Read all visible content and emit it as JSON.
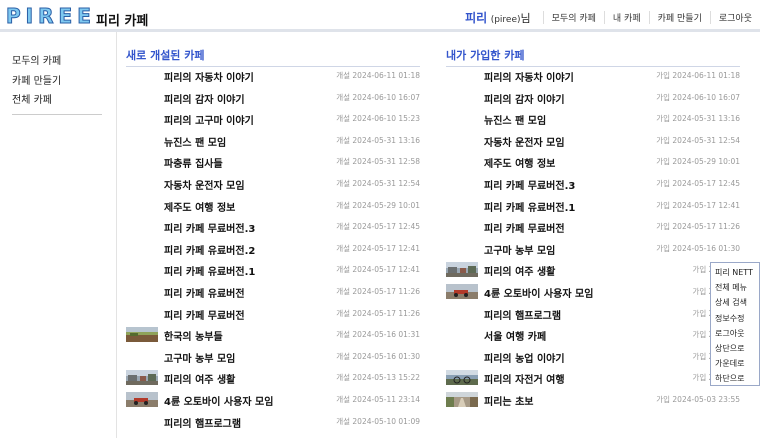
{
  "header": {
    "logo": [
      "P",
      "I",
      "R",
      "E",
      "E"
    ],
    "site_title": "피리 카페",
    "user_name": "피리",
    "user_id": "(piree)",
    "user_suffix": "님",
    "nav": [
      "모두의 카페",
      "내 카페",
      "카페 만들기",
      "로그아웃"
    ]
  },
  "sidebar": {
    "items": [
      "모두의 카페",
      "카페 만들기",
      "전체 카페"
    ],
    "active_index": 0
  },
  "new_cafes": {
    "title": "새로 개설된 카페",
    "items": [
      {
        "name": "피리의 자동차 이야기",
        "date": "개설 2024-06-11 01:18",
        "thumb": false
      },
      {
        "name": "피리의 감자 이야기",
        "date": "개설 2024-06-10 16:07",
        "thumb": false
      },
      {
        "name": "피리의 고구마 이야기",
        "date": "개설 2024-06-10 15:23",
        "thumb": false
      },
      {
        "name": "뉴진스 팬 모임",
        "date": "개설 2024-05-31 13:16",
        "thumb": false
      },
      {
        "name": "파충류 집사들",
        "date": "개설 2024-05-31 12:58",
        "thumb": false
      },
      {
        "name": "자동차 운전자 모임",
        "date": "개설 2024-05-31 12:54",
        "thumb": false
      },
      {
        "name": "제주도 여행 정보",
        "date": "개설 2024-05-29 10:01",
        "thumb": false
      },
      {
        "name": "피리 카페 무료버전.3",
        "date": "개설 2024-05-17 12:45",
        "thumb": false
      },
      {
        "name": "피리 카페 유료버전.2",
        "date": "개설 2024-05-17 12:41",
        "thumb": false
      },
      {
        "name": "피리 카페 유료버전.1",
        "date": "개설 2024-05-17 12:41",
        "thumb": false
      },
      {
        "name": "피리 카페 유료버전",
        "date": "개설 2024-05-17 11:26",
        "thumb": false
      },
      {
        "name": "피리 카페 무료버전",
        "date": "개설 2024-05-17 11:26",
        "thumb": false
      },
      {
        "name": "한국의 농부들",
        "date": "개설 2024-05-16 01:31",
        "thumb": "field"
      },
      {
        "name": "고구마 농부 모임",
        "date": "개설 2024-05-16 01:30",
        "thumb": false
      },
      {
        "name": "피리의 여주 생활",
        "date": "개설 2024-05-13 15:22",
        "thumb": "town"
      },
      {
        "name": "4륜 오토바이 사용자 모임",
        "date": "개설 2024-05-11 23:14",
        "thumb": "atv"
      },
      {
        "name": "피리의 햄프로그램",
        "date": "개설 2024-05-10 01:09",
        "thumb": false
      }
    ]
  },
  "joined_cafes": {
    "title": "내가 가입한 카페",
    "items": [
      {
        "name": "피리의 자동차 이야기",
        "date": "가입 2024-06-11 01:18",
        "thumb": false
      },
      {
        "name": "피리의 감자 이야기",
        "date": "가입 2024-06-10 16:07",
        "thumb": false
      },
      {
        "name": "뉴진스 팬 모임",
        "date": "가입 2024-05-31 13:16",
        "thumb": false
      },
      {
        "name": "자동차 운전자 모임",
        "date": "가입 2024-05-31 12:54",
        "thumb": false
      },
      {
        "name": "제주도 여행 정보",
        "date": "가입 2024-05-29 10:01",
        "thumb": false
      },
      {
        "name": "피리 카페 무료버전.3",
        "date": "가입 2024-05-17 12:45",
        "thumb": false
      },
      {
        "name": "피리 카페 유료버전.1",
        "date": "가입 2024-05-17 12:41",
        "thumb": false
      },
      {
        "name": "피리 카페 무료버전",
        "date": "가입 2024-05-17 11:26",
        "thumb": false
      },
      {
        "name": "고구마 농부 모임",
        "date": "가입 2024-05-16 01:30",
        "thumb": false
      },
      {
        "name": "피리의 여주 생활",
        "date": "가입 2024-05",
        "thumb": "town"
      },
      {
        "name": "4륜 오토바이 사용자 모임",
        "date": "가입 2024-05",
        "thumb": "atv"
      },
      {
        "name": "피리의 햄프로그램",
        "date": "가입 2024-05",
        "thumb": false
      },
      {
        "name": "서울 여행 카페",
        "date": "가입 2024-05",
        "thumb": false
      },
      {
        "name": "피리의 농업 이야기",
        "date": "가입 2024-05",
        "thumb": false
      },
      {
        "name": "피리의 자전거 여행",
        "date": "가입 2024-05",
        "thumb": "bike"
      },
      {
        "name": "피리는 초보",
        "date": "가입 2024-05-03 23:55",
        "thumb": "path"
      }
    ]
  },
  "float_menu": [
    "피리 NETT",
    "전체 메뉴",
    "상세 검색",
    "정보수정",
    "로그아웃",
    "상단으로",
    "가운데로",
    "하단으로"
  ],
  "colors": {
    "accent": "#3355cc",
    "sidebar_active": "#3366cc",
    "date": "#999999"
  }
}
